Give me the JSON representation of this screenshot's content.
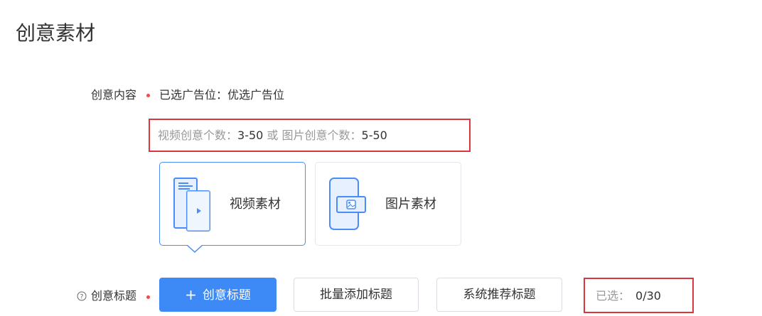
{
  "section": {
    "title": "创意素材"
  },
  "content_row": {
    "label": "创意内容",
    "placement": "已选广告位：优选广告位",
    "counts": {
      "video_label": "视频创意个数：",
      "video_range": "3-50",
      "separator": " 或 ",
      "image_label": "图片创意个数：",
      "image_range": "5-50"
    }
  },
  "material_cards": [
    {
      "label": "视频素材",
      "icon": "video-material-icon",
      "active": true
    },
    {
      "label": "图片素材",
      "icon": "image-material-icon",
      "active": false
    }
  ],
  "title_row": {
    "label": "创意标题",
    "help_icon": "question-circle-icon",
    "add_button": "创意标题",
    "batch_button": "批量添加标题",
    "recommend_button": "系统推荐标题",
    "selected_label": "已选：",
    "selected_value": "0/30"
  },
  "colors": {
    "primary": "#3d8af7",
    "required": "#f5484c",
    "highlight_border": "#d9363e",
    "card_active_border": "#4a8df8",
    "icon_fill": "#e6f0fe",
    "icon_stroke": "#4a8df8"
  }
}
